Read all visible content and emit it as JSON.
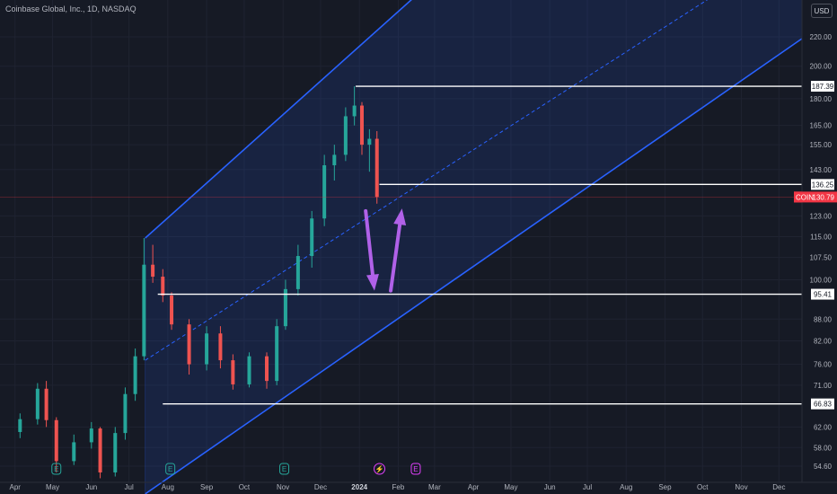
{
  "header": {
    "title": "Coinbase Global, Inc., 1D, NASDAQ",
    "currency_button": "USD"
  },
  "colors": {
    "bg": "#161a25",
    "channel": "#2962ff",
    "up": "#26a69a",
    "down": "#ef5350",
    "arrow": "#b061e8",
    "level": "#ffffff",
    "price_tag": "#f23645"
  },
  "chart_data": {
    "type": "candlestick",
    "yscale": "log",
    "ylim": [
      52.5,
      245
    ],
    "y_ticks": [
      "220.00",
      "200.00",
      "180.00",
      "165.00",
      "155.00",
      "143.00",
      "123.00",
      "115.00",
      "107.50",
      "100.00",
      "88.00",
      "82.00",
      "76.00",
      "71.00",
      "62.00",
      "58.00",
      "54.60"
    ],
    "x_ticks": [
      "Apr",
      "May",
      "Jun",
      "Jul",
      "Aug",
      "Sep",
      "Oct",
      "Nov",
      "Dec",
      "2024",
      "Feb",
      "Mar",
      "Apr",
      "May",
      "Jun",
      "Jul",
      "Aug",
      "Sep",
      "Oct",
      "Nov",
      "Dec"
    ],
    "ohlc": [
      {
        "date": "2023-04-05",
        "o": 61.0,
        "h": 64.8,
        "l": 59.8,
        "c": 63.6
      },
      {
        "date": "2023-04-19",
        "o": 63.6,
        "h": 71.5,
        "l": 62.5,
        "c": 70.2
      },
      {
        "date": "2023-04-26",
        "o": 70.2,
        "h": 72.0,
        "l": 62.0,
        "c": 63.4
      },
      {
        "date": "2023-05-04",
        "o": 63.4,
        "h": 64.0,
        "l": 53.5,
        "c": 55.5
      },
      {
        "date": "2023-05-18",
        "o": 55.5,
        "h": 60.5,
        "l": 54.8,
        "c": 59.0
      },
      {
        "date": "2023-06-01",
        "o": 59.0,
        "h": 63.0,
        "l": 57.8,
        "c": 61.7
      },
      {
        "date": "2023-06-08",
        "o": 61.7,
        "h": 62.0,
        "l": 52.5,
        "c": 53.5
      },
      {
        "date": "2023-06-20",
        "o": 53.5,
        "h": 62.0,
        "l": 52.8,
        "c": 60.8
      },
      {
        "date": "2023-06-28",
        "o": 60.8,
        "h": 70.5,
        "l": 59.5,
        "c": 69.0
      },
      {
        "date": "2023-07-06",
        "o": 69.0,
        "h": 80.0,
        "l": 67.5,
        "c": 78.0
      },
      {
        "date": "2023-07-13",
        "o": 78.0,
        "h": 114.5,
        "l": 77.0,
        "c": 105.0
      },
      {
        "date": "2023-07-20",
        "o": 105.0,
        "h": 112.0,
        "l": 99.0,
        "c": 101.0
      },
      {
        "date": "2023-07-28",
        "o": 101.0,
        "h": 103.5,
        "l": 93.0,
        "c": 95.0
      },
      {
        "date": "2023-08-04",
        "o": 95.0,
        "h": 96.0,
        "l": 85.0,
        "c": 86.5
      },
      {
        "date": "2023-08-18",
        "o": 86.5,
        "h": 88.0,
        "l": 73.5,
        "c": 76.0
      },
      {
        "date": "2023-09-01",
        "o": 76.0,
        "h": 86.0,
        "l": 74.5,
        "c": 84.0
      },
      {
        "date": "2023-09-12",
        "o": 84.0,
        "h": 86.0,
        "l": 75.0,
        "c": 77.0
      },
      {
        "date": "2023-09-22",
        "o": 77.0,
        "h": 78.5,
        "l": 70.0,
        "c": 71.2
      },
      {
        "date": "2023-10-05",
        "o": 71.2,
        "h": 79.0,
        "l": 70.5,
        "c": 78.0
      },
      {
        "date": "2023-10-19",
        "o": 78.0,
        "h": 79.0,
        "l": 70.2,
        "c": 72.0
      },
      {
        "date": "2023-10-27",
        "o": 72.0,
        "h": 88.0,
        "l": 71.0,
        "c": 86.0
      },
      {
        "date": "2023-11-03",
        "o": 86.0,
        "h": 100.0,
        "l": 85.0,
        "c": 97.0
      },
      {
        "date": "2023-11-13",
        "o": 97.0,
        "h": 112.0,
        "l": 95.0,
        "c": 108.0
      },
      {
        "date": "2023-11-24",
        "o": 108.0,
        "h": 125.0,
        "l": 104.0,
        "c": 122.0
      },
      {
        "date": "2023-12-04",
        "o": 122.0,
        "h": 150.0,
        "l": 119.0,
        "c": 145.0
      },
      {
        "date": "2023-12-12",
        "o": 145.0,
        "h": 155.0,
        "l": 138.0,
        "c": 150.0
      },
      {
        "date": "2023-12-21",
        "o": 150.0,
        "h": 175.0,
        "l": 147.0,
        "c": 170.0
      },
      {
        "date": "2023-12-28",
        "o": 170.0,
        "h": 187.39,
        "l": 165.0,
        "c": 176.0
      },
      {
        "date": "2024-01-03",
        "o": 176.0,
        "h": 178.0,
        "l": 150.0,
        "c": 155.0
      },
      {
        "date": "2024-01-09",
        "o": 155.0,
        "h": 163.0,
        "l": 142.0,
        "c": 158.0
      },
      {
        "date": "2024-01-15",
        "o": 158.0,
        "h": 162.0,
        "l": 128.0,
        "c": 130.79
      }
    ],
    "annotations": {
      "levels": [
        {
          "label": "187.39",
          "value": 187.39
        },
        {
          "label": "136.25",
          "value": 136.25
        },
        {
          "label": "95.41",
          "value": 95.41
        },
        {
          "label": "66.83",
          "value": 66.83
        }
      ],
      "current_price": {
        "symbol": "COIN",
        "label": "130.79",
        "value": 130.79
      },
      "channel": {
        "lower": [
          {
            "date": "2023-08-01",
            "value": 52.5
          },
          {
            "date": "2024-12-31",
            "value": 226.0
          }
        ],
        "upper": [
          {
            "date": "2023-07-14",
            "value": 114.5
          },
          {
            "date": "2024-02-08",
            "value": 245.0
          }
        ],
        "mid": [
          {
            "date": "2023-07-14",
            "value": 77.0
          },
          {
            "date": "2024-09-30",
            "value": 245.0
          }
        ]
      },
      "arrows": [
        {
          "from": {
            "date": "2024-01-06",
            "value": 125.0
          },
          "to": {
            "date": "2024-01-13",
            "value": 96.5
          }
        },
        {
          "from": {
            "date": "2024-01-26",
            "value": 96.5
          },
          "to": {
            "date": "2024-02-04",
            "value": 126.0
          }
        }
      ],
      "event_markers": [
        {
          "kind": "earnings",
          "letter": "E",
          "date": "2023-05-04"
        },
        {
          "kind": "earnings",
          "letter": "E",
          "date": "2023-08-03"
        },
        {
          "kind": "earnings",
          "letter": "E",
          "date": "2023-11-02"
        },
        {
          "kind": "split",
          "letter": "⚡",
          "date": "2024-01-17"
        },
        {
          "kind": "earnings",
          "letter": "E",
          "date": "2024-02-15"
        }
      ]
    }
  }
}
